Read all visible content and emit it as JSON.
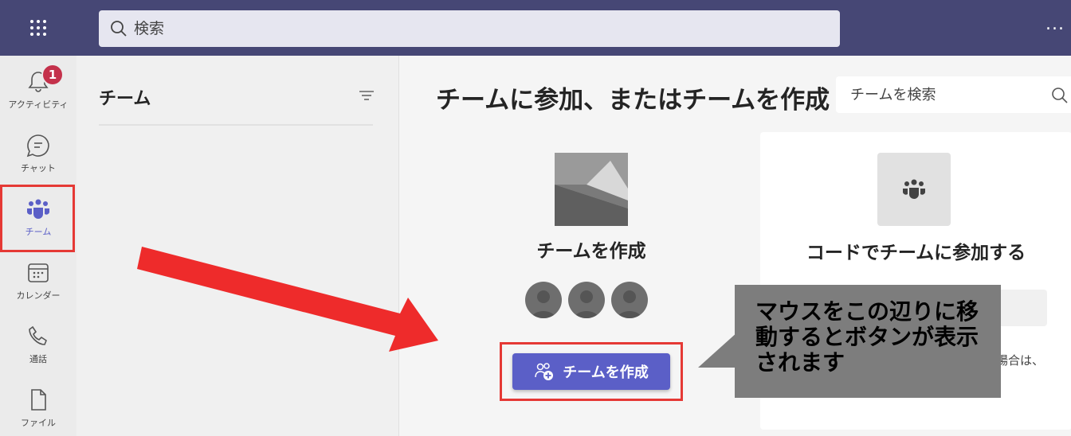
{
  "topbar": {
    "search_placeholder": "検索",
    "more_label": "..."
  },
  "rail": {
    "items": [
      {
        "label": "アクティビティ",
        "icon": "bell-icon",
        "badge": "1"
      },
      {
        "label": "チャット",
        "icon": "chat-icon"
      },
      {
        "label": "チーム",
        "icon": "teams-icon",
        "active": true
      },
      {
        "label": "カレンダー",
        "icon": "calendar-icon"
      },
      {
        "label": "通話",
        "icon": "phone-icon"
      },
      {
        "label": "ファイル",
        "icon": "file-icon"
      }
    ]
  },
  "teams_panel": {
    "title": "チーム",
    "filter_icon": "filter-icon"
  },
  "main": {
    "title": "チームに参加、またはチームを作成",
    "search_placeholder": "チームを検索",
    "create_card": {
      "label": "チームを作成",
      "button_label": "チームを作成"
    },
    "join_card": {
      "label": "コードでチームに参加する",
      "hint": "場合は、"
    }
  },
  "annotation": {
    "callout_text": "マウスをこの辺りに移動するとボタンが表示されます"
  },
  "colors": {
    "topbar": "#464775",
    "accent": "#5b5fc7",
    "highlight": "#e53935",
    "badge": "#c4314b"
  }
}
